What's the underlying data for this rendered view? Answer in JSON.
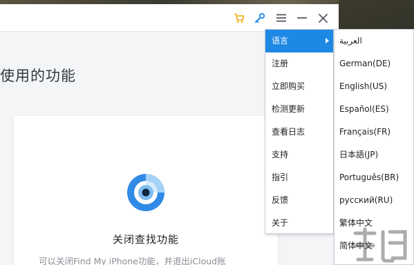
{
  "header": {
    "icons": [
      "cart-icon",
      "key-icon",
      "menu-icon",
      "minimize-icon",
      "close-icon"
    ]
  },
  "main": {
    "heading": "使用的功能",
    "card": {
      "title": "关闭查找功能",
      "description": "可以关闭Find My iPhone功能，并退出iCloud账"
    }
  },
  "menu": {
    "items": [
      {
        "label": "语言"
      },
      {
        "label": "注册"
      },
      {
        "label": "立即购买"
      },
      {
        "label": "检测更新"
      },
      {
        "label": "查看日志"
      },
      {
        "label": "支持"
      },
      {
        "label": "指引"
      },
      {
        "label": "反馈"
      },
      {
        "label": "关于"
      }
    ]
  },
  "language_menu": {
    "items": [
      {
        "label": "العربية"
      },
      {
        "label": "German(DE)"
      },
      {
        "label": "English(US)"
      },
      {
        "label": "Español(ES)"
      },
      {
        "label": "Français(FR)"
      },
      {
        "label": "日本語(JP)"
      },
      {
        "label": "Português(BR)"
      },
      {
        "label": "русский(RU)"
      },
      {
        "label": "繁体中文"
      },
      {
        "label": "简体中文"
      }
    ]
  },
  "colors": {
    "accent": "#1e88e5",
    "cart_icon": "#f0a800",
    "key_icon": "#1e88e5"
  }
}
